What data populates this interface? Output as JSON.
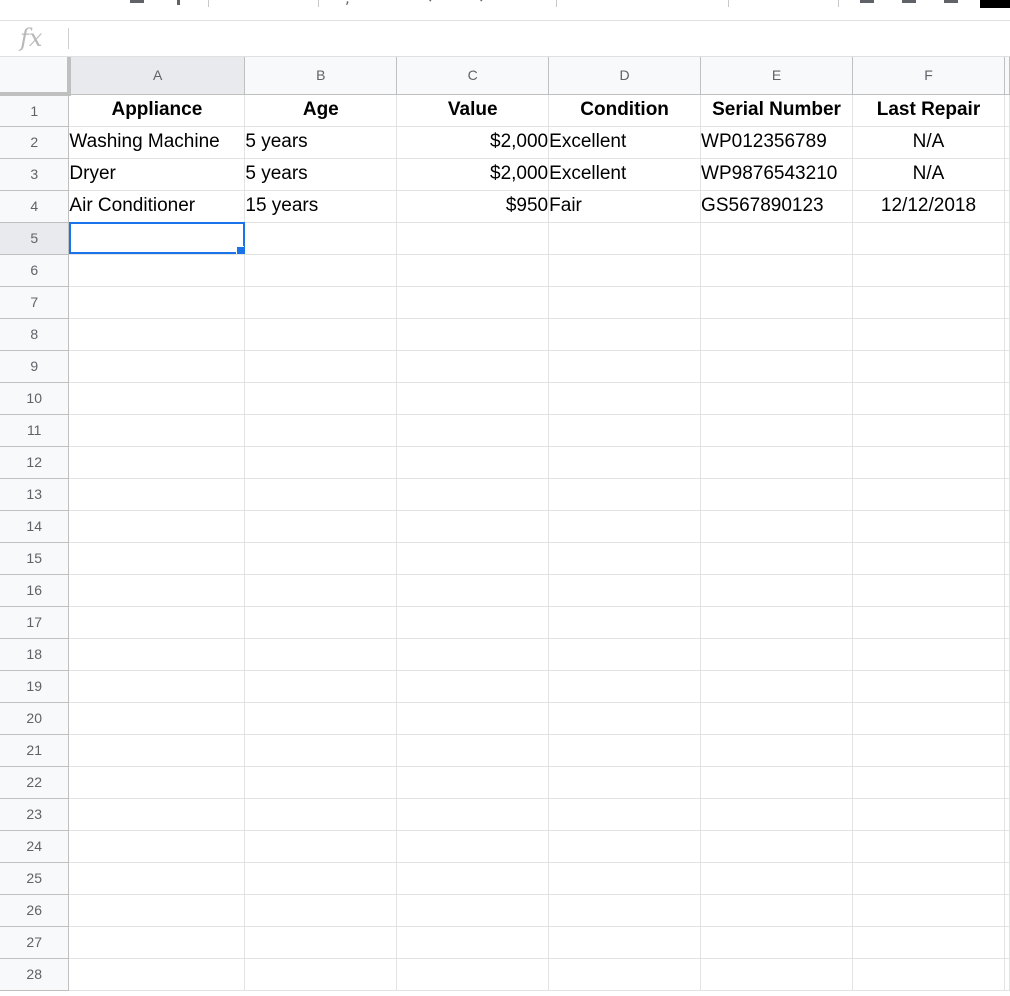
{
  "formula_bar": {
    "icon": "fx-icon",
    "value": ""
  },
  "colors": {
    "selection": "#1a73e8",
    "header_bg": "#f8f9fa",
    "active_header_bg": "#e8eaed",
    "gridline": "#e2e3e3"
  },
  "grid": {
    "columns": [
      "A",
      "B",
      "C",
      "D",
      "E",
      "F"
    ],
    "active_column": "A",
    "active_row": 5,
    "selected_cell": "A5",
    "rows": [
      {
        "num": "1",
        "cells": [
          "Appliance",
          "Age",
          "Value",
          "Condition",
          "Serial Number",
          "Last Repair"
        ]
      },
      {
        "num": "2",
        "cells": [
          "Washing Machine",
          "5 years",
          "$2,000",
          "Excellent",
          "WP012356789",
          "N/A"
        ]
      },
      {
        "num": "3",
        "cells": [
          "Dryer",
          "5 years",
          "$2,000",
          "Excellent",
          "WP9876543210",
          "N/A"
        ]
      },
      {
        "num": "4",
        "cells": [
          "Air Conditioner",
          "15 years",
          "$950",
          "Fair",
          "GS567890123",
          "12/12/2018"
        ]
      },
      {
        "num": "5",
        "cells": [
          "",
          "",
          "",
          "",
          "",
          ""
        ]
      },
      {
        "num": "6",
        "cells": [
          "",
          "",
          "",
          "",
          "",
          ""
        ]
      },
      {
        "num": "7",
        "cells": [
          "",
          "",
          "",
          "",
          "",
          ""
        ]
      },
      {
        "num": "8",
        "cells": [
          "",
          "",
          "",
          "",
          "",
          ""
        ]
      },
      {
        "num": "9",
        "cells": [
          "",
          "",
          "",
          "",
          "",
          ""
        ]
      },
      {
        "num": "10",
        "cells": [
          "",
          "",
          "",
          "",
          "",
          ""
        ]
      },
      {
        "num": "11",
        "cells": [
          "",
          "",
          "",
          "",
          "",
          ""
        ]
      },
      {
        "num": "12",
        "cells": [
          "",
          "",
          "",
          "",
          "",
          ""
        ]
      },
      {
        "num": "13",
        "cells": [
          "",
          "",
          "",
          "",
          "",
          ""
        ]
      },
      {
        "num": "14",
        "cells": [
          "",
          "",
          "",
          "",
          "",
          ""
        ]
      },
      {
        "num": "15",
        "cells": [
          "",
          "",
          "",
          "",
          "",
          ""
        ]
      },
      {
        "num": "16",
        "cells": [
          "",
          "",
          "",
          "",
          "",
          ""
        ]
      },
      {
        "num": "17",
        "cells": [
          "",
          "",
          "",
          "",
          "",
          ""
        ]
      },
      {
        "num": "18",
        "cells": [
          "",
          "",
          "",
          "",
          "",
          ""
        ]
      },
      {
        "num": "19",
        "cells": [
          "",
          "",
          "",
          "",
          "",
          ""
        ]
      },
      {
        "num": "20",
        "cells": [
          "",
          "",
          "",
          "",
          "",
          ""
        ]
      },
      {
        "num": "21",
        "cells": [
          "",
          "",
          "",
          "",
          "",
          ""
        ]
      },
      {
        "num": "22",
        "cells": [
          "",
          "",
          "",
          "",
          "",
          ""
        ]
      },
      {
        "num": "23",
        "cells": [
          "",
          "",
          "",
          "",
          "",
          ""
        ]
      },
      {
        "num": "24",
        "cells": [
          "",
          "",
          "",
          "",
          "",
          ""
        ]
      },
      {
        "num": "25",
        "cells": [
          "",
          "",
          "",
          "",
          "",
          ""
        ]
      },
      {
        "num": "26",
        "cells": [
          "",
          "",
          "",
          "",
          "",
          ""
        ]
      },
      {
        "num": "27",
        "cells": [
          "",
          "",
          "",
          "",
          "",
          ""
        ]
      },
      {
        "num": "28",
        "cells": [
          "",
          "",
          "",
          "",
          "",
          ""
        ]
      }
    ]
  }
}
